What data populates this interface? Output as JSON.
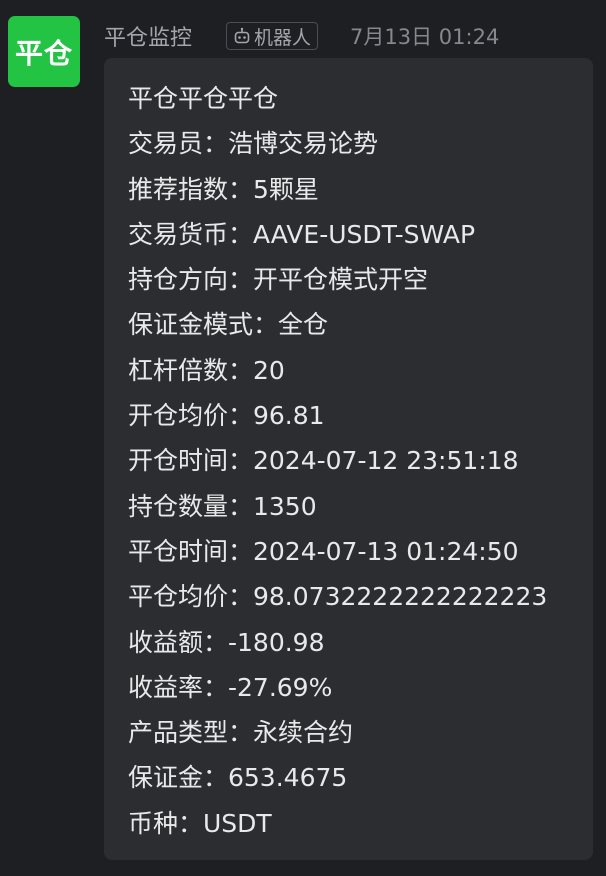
{
  "avatar": {
    "text": "平仓"
  },
  "header": {
    "sender": "平仓监控",
    "badge_label": "机器人",
    "timestamp": "7月13日 01:24"
  },
  "message": {
    "lines": [
      "平仓平仓平仓",
      "交易员：浩博交易论势",
      "推荐指数：5颗星",
      "交易货币：AAVE-USDT-SWAP",
      "持仓方向：开平仓模式开空",
      "保证金模式：全仓",
      "杠杆倍数：20",
      "开仓均价：96.81",
      "开仓时间：2024-07-12 23:51:18",
      "持仓数量：1350",
      "平仓时间：2024-07-13 01:24:50",
      "平仓均价：98.0732222222222223",
      "收益额：-180.98",
      "收益率：-27.69%",
      "产品类型：永续合约",
      "保证金：653.4675",
      "币种：USDT"
    ]
  },
  "colors": {
    "background": "#1e1f22",
    "bubble": "#2b2d31",
    "avatar": "#23c343",
    "text": "#e8e9ea",
    "muted": "#a2a5aa"
  },
  "icons": {
    "badge": "robot-icon"
  }
}
